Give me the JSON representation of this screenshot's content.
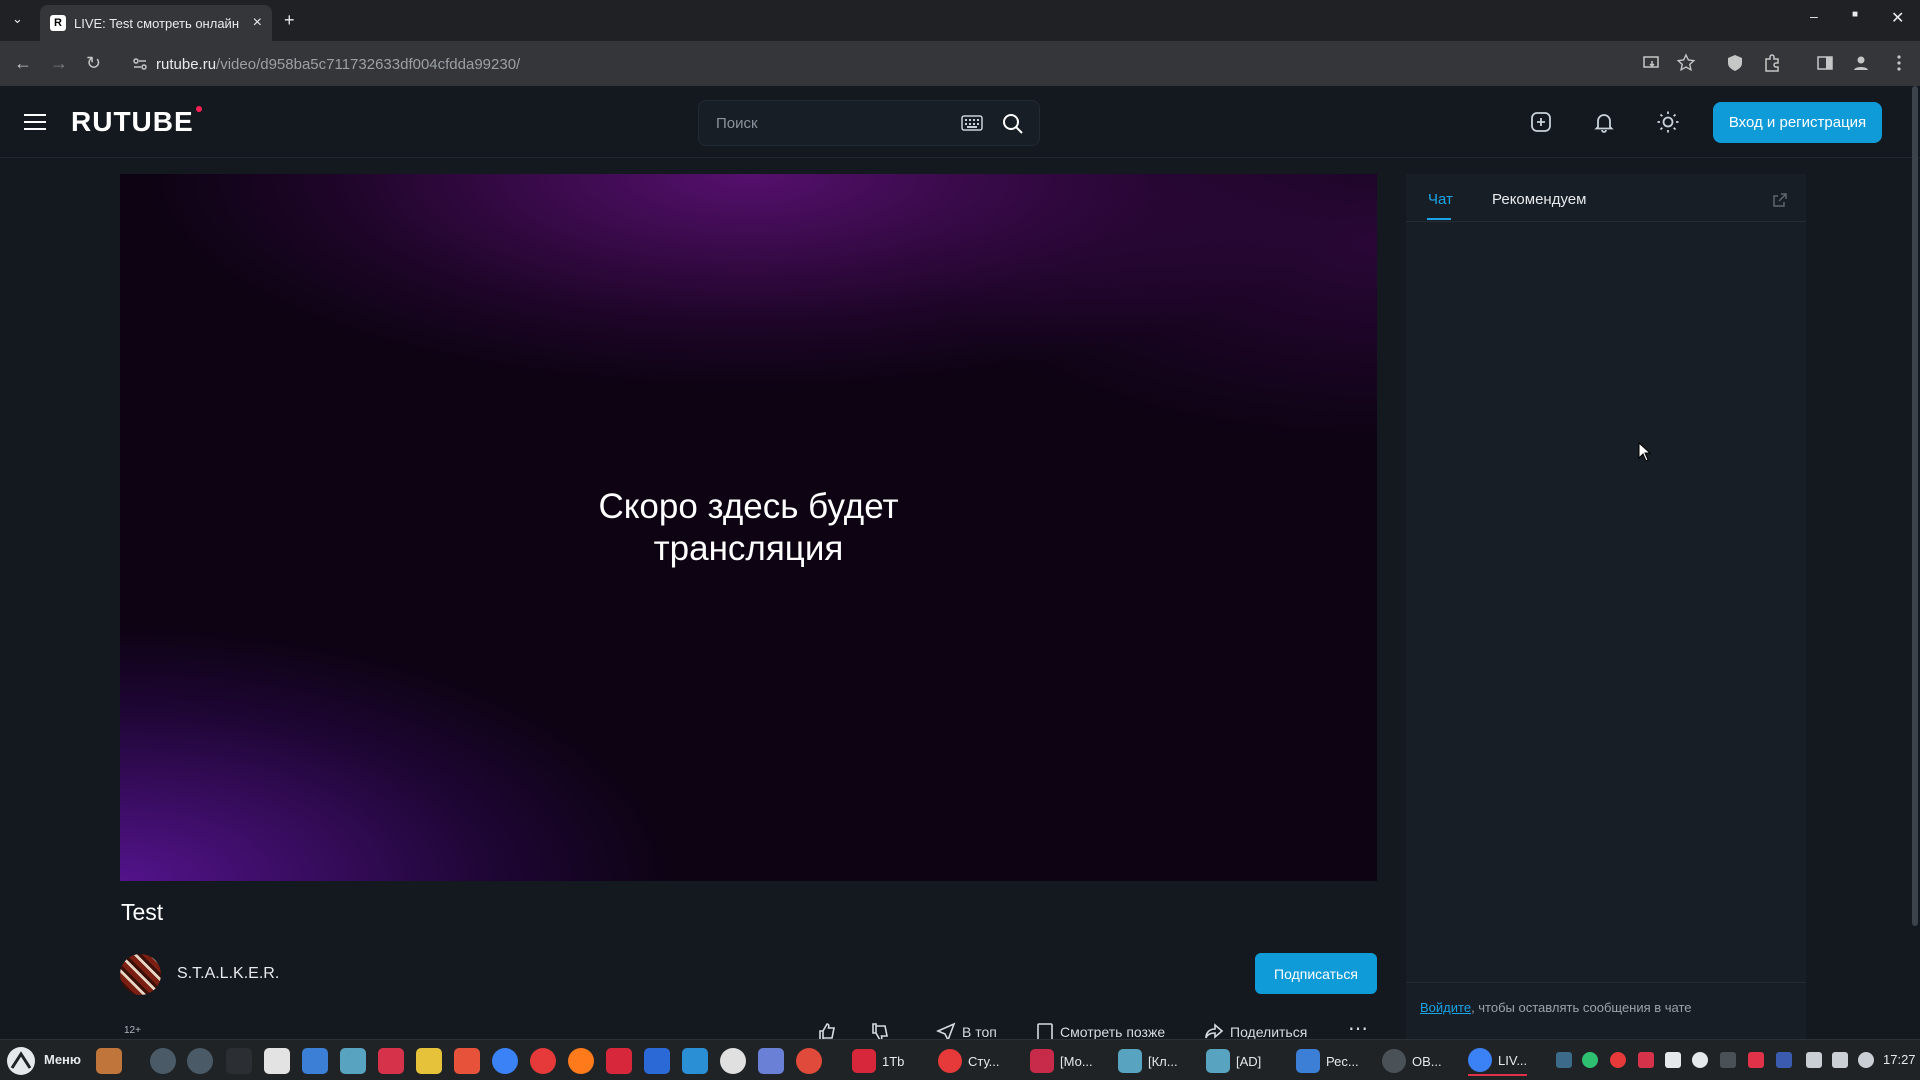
{
  "browser": {
    "tab_title": "LIVE: Test смотреть онлайн",
    "tab_favicon": "R",
    "url_host": "rutube.ru",
    "url_path": "/video/d958ba5c711732633df004cfdda99230/"
  },
  "site": {
    "logo": "RUTUBE",
    "search_placeholder": "Поиск",
    "login_label": "Вход и регистрация",
    "accent_color": "#0f9ad8"
  },
  "player": {
    "message": "Скоро здесь будет трансляция"
  },
  "video": {
    "title": "Test",
    "channel": "S.T.A.L.K.E.R.",
    "subscribe_label": "Подписаться",
    "age_rating": "12+",
    "actions": {
      "top_label": "В топ",
      "later_label": "Смотреть позже",
      "share_label": "Поделиться"
    }
  },
  "side_panel": {
    "tab_chat": "Чат",
    "tab_recommended": "Рекомендуем",
    "login_link": "Войдите",
    "login_hint": ", чтобы оставлять сообщения в чате"
  },
  "taskbar": {
    "menu_label": "Меню",
    "windows": [
      {
        "label": "1Tb"
      },
      {
        "label": "Сту..."
      },
      {
        "label": "[Мо..."
      },
      {
        "label": "[Кл..."
      },
      {
        "label": "[AD]"
      },
      {
        "label": "Рес..."
      },
      {
        "label": "ОВ..."
      },
      {
        "label": "LIV..."
      }
    ],
    "clock": "17:27"
  }
}
